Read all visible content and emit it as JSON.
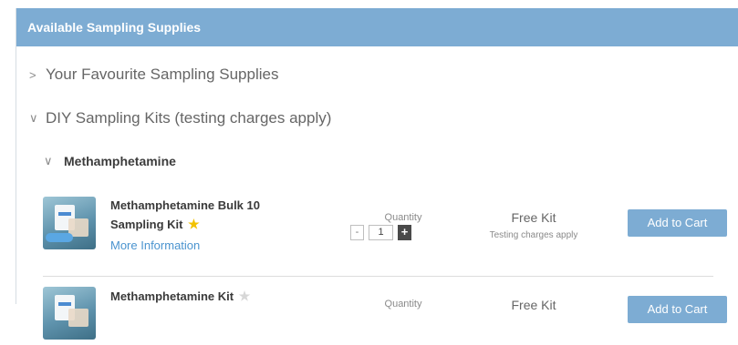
{
  "panel": {
    "title": "Available Sampling Supplies"
  },
  "sections": [
    {
      "label": "Your Favourite Sampling Supplies",
      "expanded": false,
      "chevron": ">"
    },
    {
      "label": "DIY Sampling Kits (testing charges apply)",
      "expanded": true,
      "chevron": "∨"
    }
  ],
  "subsection": {
    "label": "Methamphetamine",
    "chevron": "∨"
  },
  "products": [
    {
      "name": "Methamphetamine Bulk 10 Sampling Kit",
      "favourite": true,
      "more_info": "More Information",
      "quantity_label": "Quantity",
      "quantity": "1",
      "minus": "-",
      "plus": "+",
      "price": "Free Kit",
      "note": "Testing charges apply",
      "button": "Add to Cart"
    },
    {
      "name": "Methamphetamine Kit",
      "favourite": false,
      "quantity_label": "Quantity",
      "price": "Free Kit",
      "button": "Add to Cart"
    }
  ],
  "icons": {
    "star": "★"
  },
  "colors": {
    "accent": "#7dacd3",
    "link": "#4b94cf",
    "star_on": "#f2c200",
    "star_off": "#d7d7d7"
  }
}
